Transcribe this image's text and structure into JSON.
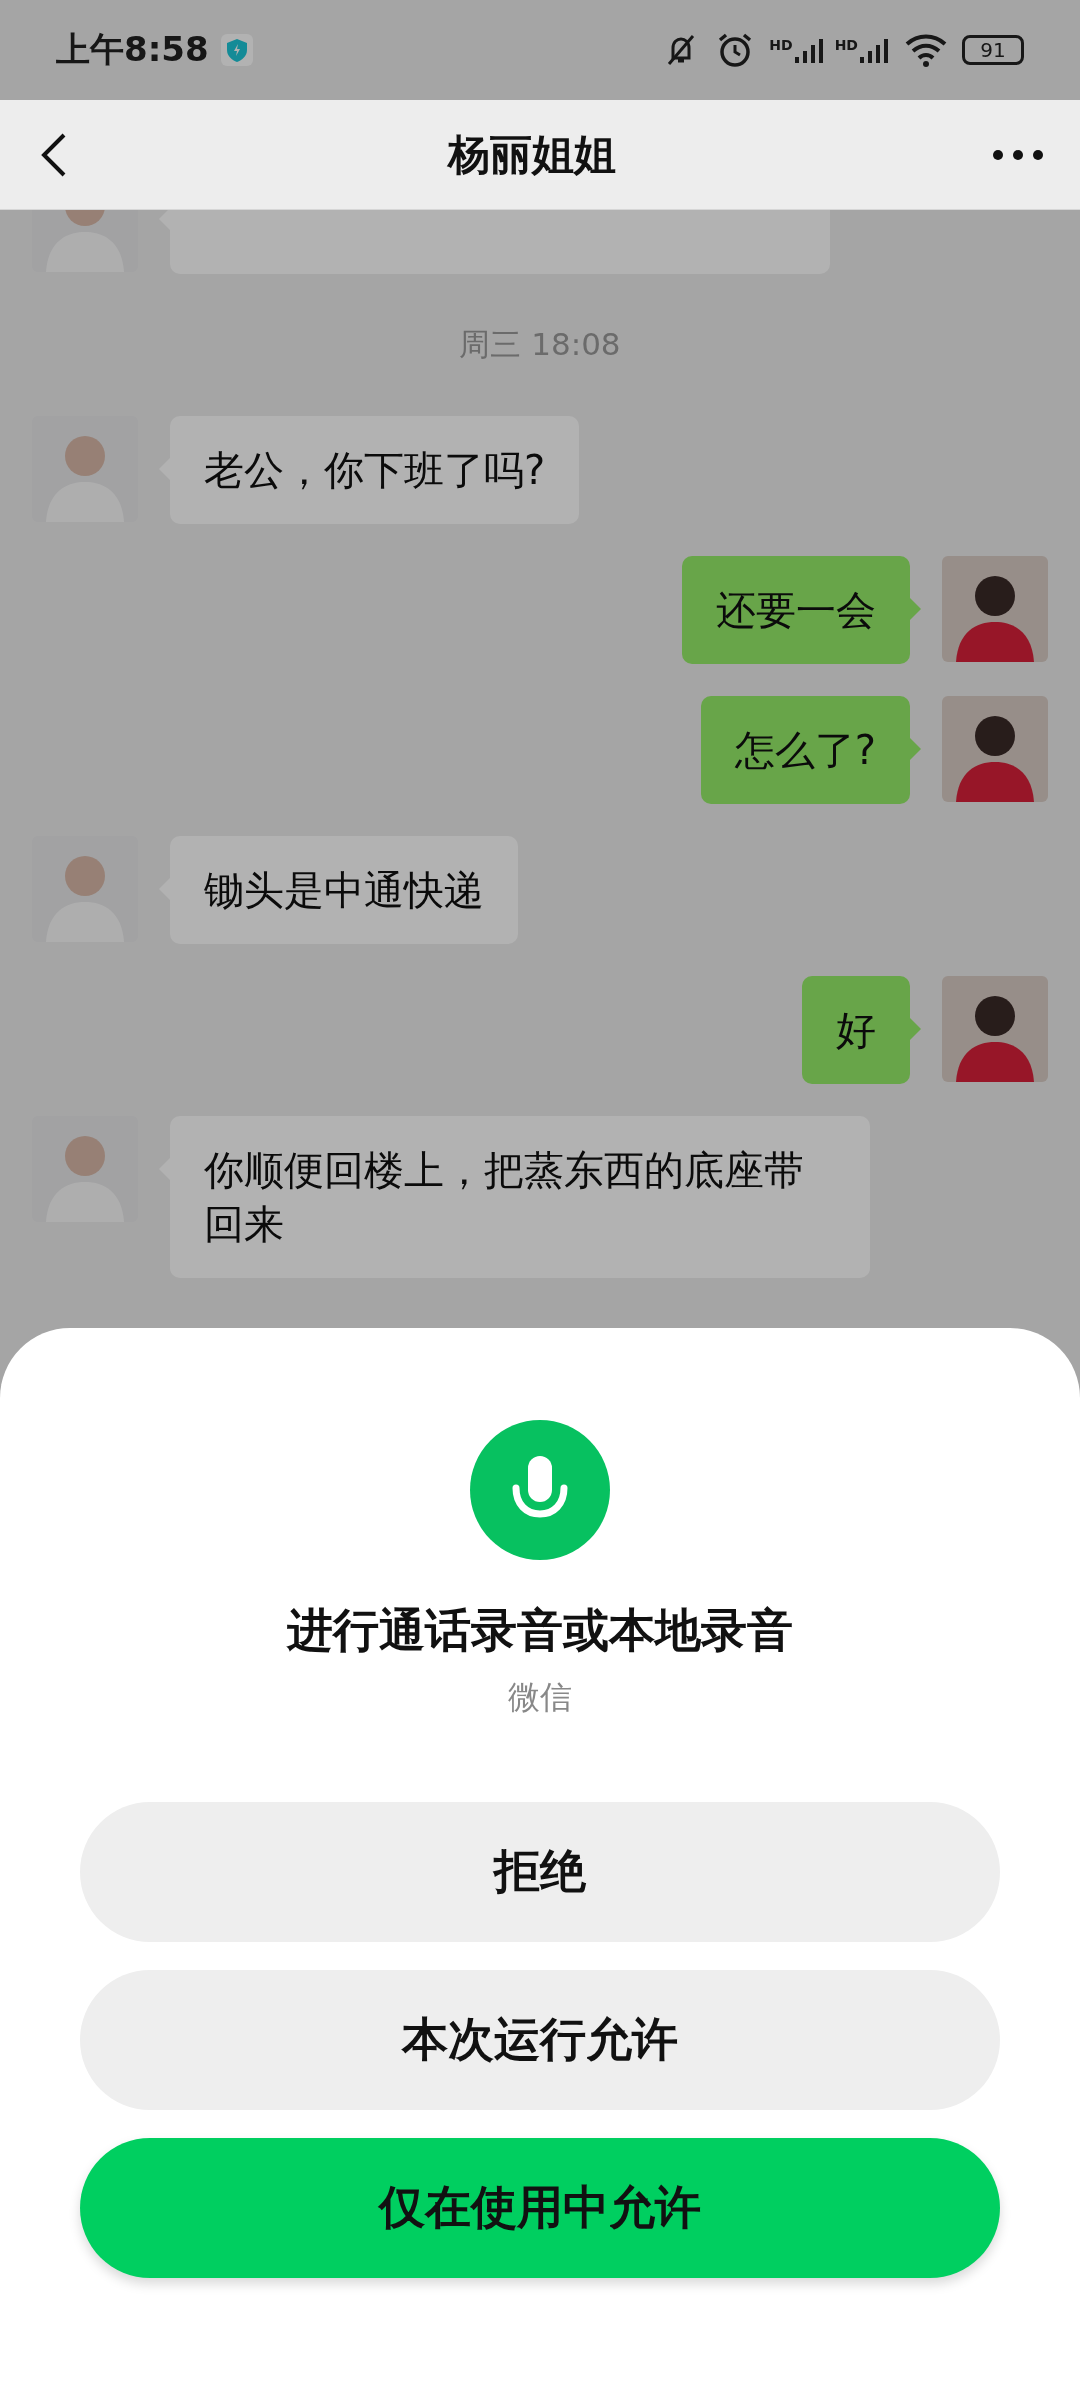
{
  "status_bar": {
    "time": "上午8:58",
    "signal_labels": [
      "HD",
      "HD"
    ],
    "battery": "91"
  },
  "header": {
    "title": "杨丽姐姐"
  },
  "messages": [
    {
      "kind": "received"
    },
    {
      "kind": "time",
      "text": "周三 18:08"
    },
    {
      "kind": "received",
      "text": "老公，你下班了吗?"
    },
    {
      "kind": "sent",
      "text": "还要一会"
    },
    {
      "kind": "sent",
      "text": "怎么了?"
    },
    {
      "kind": "received",
      "text": "锄头是中通快递"
    },
    {
      "kind": "sent",
      "text": "好"
    },
    {
      "kind": "received",
      "text": "你顺便回楼上，把蒸东西的底座带回来"
    }
  ],
  "permission_dialog": {
    "title": "进行通话录音或本地录音",
    "app": "微信",
    "buttons": [
      {
        "label": "拒绝",
        "primary": false
      },
      {
        "label": "本次运行允许",
        "primary": false
      },
      {
        "label": "仅在使用中允许",
        "primary": true
      }
    ]
  }
}
